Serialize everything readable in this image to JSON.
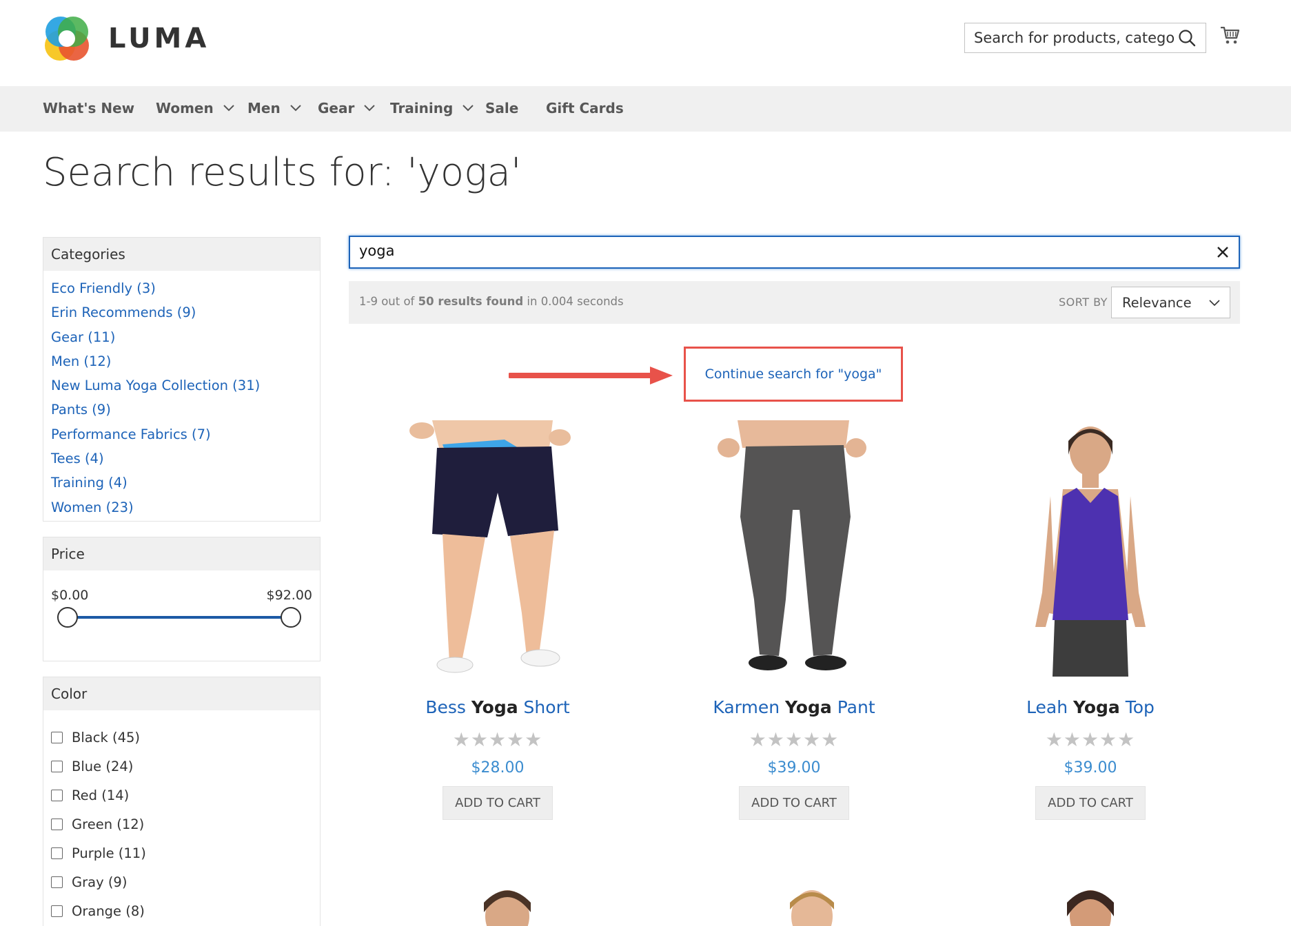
{
  "header": {
    "logo_text": "LUMA",
    "search_placeholder": "Search for products, categories, ...",
    "search_icon": "search-icon",
    "cart_icon": "cart-icon"
  },
  "nav": {
    "items": [
      {
        "label": "What's New",
        "has_dropdown": false
      },
      {
        "label": "Women",
        "has_dropdown": true
      },
      {
        "label": "Men",
        "has_dropdown": true
      },
      {
        "label": "Gear",
        "has_dropdown": true
      },
      {
        "label": "Training",
        "has_dropdown": true
      },
      {
        "label": "Sale",
        "has_dropdown": false
      },
      {
        "label": "Gift Cards",
        "has_dropdown": false
      }
    ]
  },
  "page_title": "Search results for: 'yoga'",
  "filters": {
    "categories": {
      "title": "Categories",
      "items": [
        "Eco Friendly (3)",
        "Erin Recommends (9)",
        "Gear (11)",
        "Men (12)",
        "New Luma Yoga Collection (31)",
        "Pants (9)",
        "Performance Fabrics (7)",
        "Tees (4)",
        "Training (4)",
        "Women (23)"
      ]
    },
    "price": {
      "title": "Price",
      "min_label": "$0.00",
      "max_label": "$92.00",
      "selected_min": 0,
      "selected_max": 92
    },
    "color": {
      "title": "Color",
      "items": [
        {
          "label": "Black (45)",
          "checked": false
        },
        {
          "label": "Blue (24)",
          "checked": false
        },
        {
          "label": "Red (14)",
          "checked": false
        },
        {
          "label": "Green (12)",
          "checked": false
        },
        {
          "label": "Purple (11)",
          "checked": false
        },
        {
          "label": "Gray (9)",
          "checked": false
        },
        {
          "label": "Orange (8)",
          "checked": false
        }
      ]
    }
  },
  "search": {
    "query": "yoga",
    "clear_icon": "close-icon"
  },
  "results": {
    "prefix": "1-9 out of ",
    "count_text": "50 results found",
    "suffix": " in 0.004 seconds",
    "sort_label": "SORT BY",
    "sort_value": "Relevance"
  },
  "continue_search": {
    "label": "Continue search for \"yoga\""
  },
  "products": [
    {
      "name_pre": "Bess ",
      "name_hl": "Yoga",
      "name_post": " Short",
      "price": "$28.00",
      "rating_stars": 0,
      "cta": "ADD TO CART"
    },
    {
      "name_pre": "Karmen ",
      "name_hl": "Yoga",
      "name_post": " Pant",
      "price": "$39.00",
      "rating_stars": 0,
      "cta": "ADD TO CART"
    },
    {
      "name_pre": "Leah ",
      "name_hl": "Yoga",
      "name_post": " Top",
      "price": "$39.00",
      "rating_stars": 0,
      "cta": "ADD TO CART"
    }
  ],
  "colors": {
    "link": "#1d63b8",
    "price": "#3b8ccf",
    "annotation": "#e8524a",
    "nav_bg": "#f0f0f0"
  }
}
